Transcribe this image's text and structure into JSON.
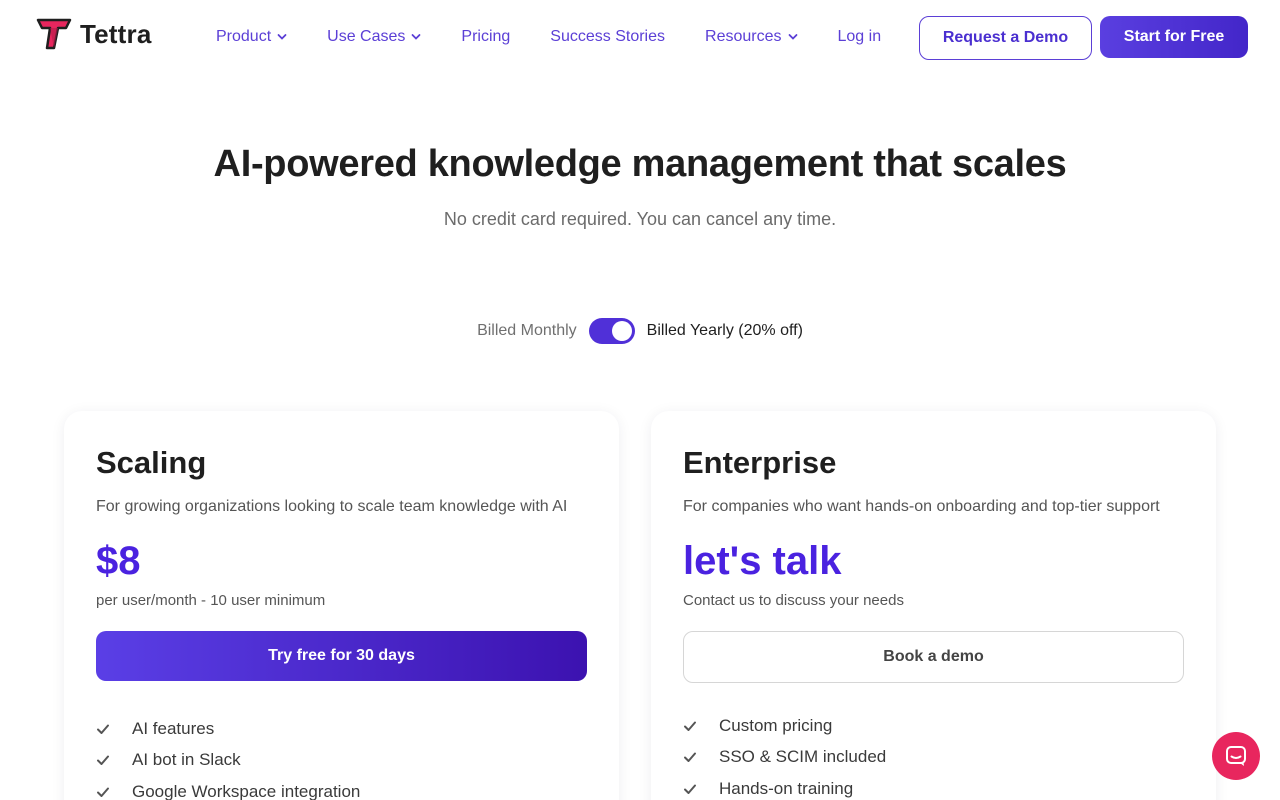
{
  "brand": {
    "name": "Tettra",
    "accent": "#5b3fd6",
    "logo_pink": "#e8265e"
  },
  "nav": {
    "links": [
      {
        "label": "Product",
        "dropdown": true
      },
      {
        "label": "Use Cases",
        "dropdown": true
      },
      {
        "label": "Pricing",
        "dropdown": false
      },
      {
        "label": "Success Stories",
        "dropdown": false
      },
      {
        "label": "Resources",
        "dropdown": true
      },
      {
        "label": "Log in",
        "dropdown": false
      }
    ],
    "request_demo": "Request a Demo",
    "start_free": "Start for Free"
  },
  "hero": {
    "title": "AI-powered knowledge management that scales",
    "subtitle": "No credit card required. You can cancel any time."
  },
  "billing": {
    "monthly_label": "Billed Monthly",
    "yearly_label": "Billed Yearly (20% off)",
    "yearly_selected": true
  },
  "plans": [
    {
      "name": "Scaling",
      "description": "For growing organizations looking to scale team knowledge with AI",
      "price": "$8",
      "price_note": "per user/month - 10 user minimum",
      "cta": "Try free for 30 days",
      "features": [
        "AI features",
        "AI bot in Slack",
        "Google Workspace integration"
      ]
    },
    {
      "name": "Enterprise",
      "description": "For companies who want hands-on onboarding and top-tier support",
      "price": "let's talk",
      "price_note": "Contact us to discuss your needs",
      "cta": "Book a demo",
      "features": [
        "Custom pricing",
        "SSO & SCIM included",
        "Hands-on training"
      ]
    }
  ],
  "chat_widget": {
    "icon": "chat-bubble-icon"
  }
}
